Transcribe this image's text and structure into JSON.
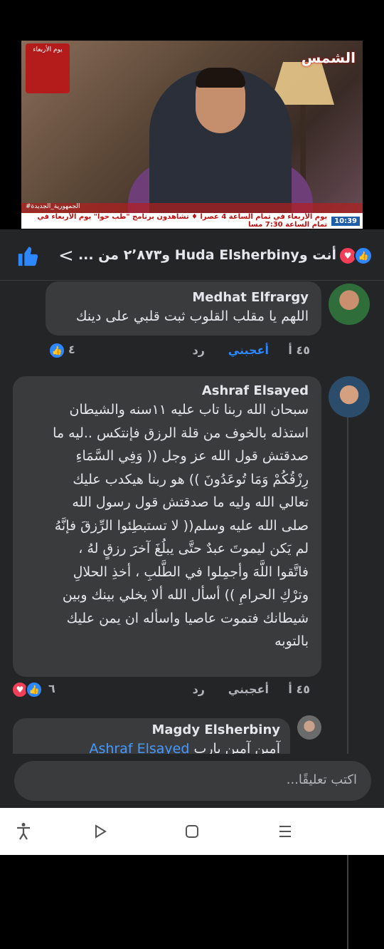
{
  "video": {
    "channel_logo": "الشمس",
    "badge_text": "يوم الأربعاء",
    "ticker_time": "10:39",
    "ticker_text": "يوم الأربعاء في تمام الساعة 4 عصرا ♦ تشاهدون برنامج \"طب حوا\" يوم الأربعاء في تمام الساعة 7:30 مسا",
    "hashtag": "#الجمهورية_الجديدة"
  },
  "reactions": {
    "summary": "أنت وHuda Elsherbiny و٢٬٨٧٣ من ...",
    "chevron": "<"
  },
  "comments": [
    {
      "name": "Medhat Elfrargy",
      "text": "اللهم يا مقلب القلوب ثبت قلبي على دينك",
      "time": "٤٥ أ",
      "like_label": "أعجبني",
      "reply_label": "رد",
      "reaction_count": "٤"
    },
    {
      "name": "Ashraf Elsayed",
      "lines": [
        "سبحان الله ربنا تاب عليه ١١سنه والشيطان",
        "استذله بالخوف من قلة الرزق فإنتكس ..ليه ما",
        "صدقتش قول الله عز وجل (( وَفِي السَّمَاءِ",
        "رِزْقُكُمْ وَمَا تُوعَدُونَ )) هو ربنا هيكدب عليك",
        "تعالي الله وليه ما صدقتش قول رسول الله",
        "صلى الله عليه وسلم(( لا تستبطِئوا الرِّزقَ فإنَّهُ",
        "لم يَكن ليموتَ عبدٌ حتَّى يبلُغَ آخرَ رزقٍ لهُ ،",
        "فاتَّقوا اللَّهَ وأجمِلوا في الطَّلبِ ، أخذِ الحلالِ",
        "وترْكِ الحرامِ )) أسأل الله ألا يخلي بينك وبين",
        "شيطانك فتموت عاصيا واسأله ان  يمن عليك",
        "بالتوبه"
      ],
      "time": "٤٥ أ",
      "like_label": "أعجبني",
      "reply_label": "رد",
      "reaction_count": "٦"
    },
    {
      "name": "Magdy Elsherbiny",
      "mention": "Ashraf Elsayed",
      "text": "آمين آمين يارب"
    }
  ],
  "composer": {
    "placeholder": "اكتب تعليقًا..."
  },
  "navbar": {
    "icons": [
      "accessibility-icon",
      "back-icon",
      "home-icon",
      "recents-icon"
    ]
  }
}
